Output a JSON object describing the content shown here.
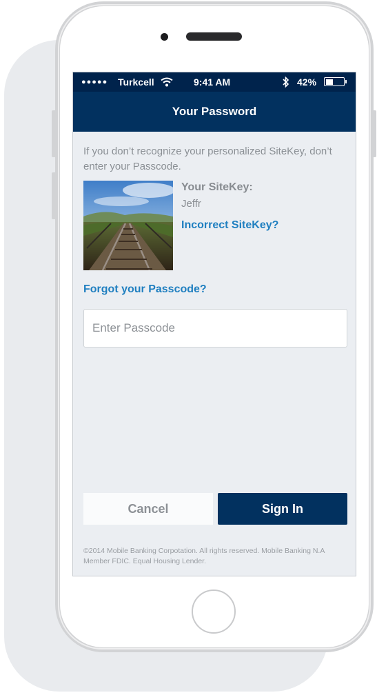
{
  "status_bar": {
    "carrier": "Turkcell",
    "signal_dots": "●●●●●",
    "time": "9:41 AM",
    "battery_percent": "42%",
    "battery_level": 0.42
  },
  "header": {
    "title": "Your Password"
  },
  "warning_text": "If you don’t recognize your personalized SiteKey, don’t enter your Passcode.",
  "sitekey": {
    "label": "Your SiteKey:",
    "name": "Jeffr",
    "incorrect_link": "Incorrect SiteKey?"
  },
  "forgot_link": "Forgot your Passcode?",
  "passcode": {
    "placeholder": "Enter Passcode",
    "value": ""
  },
  "buttons": {
    "cancel": "Cancel",
    "sign_in": "Sign In"
  },
  "footer": "©2014 Mobile Banking Corpotation. All rights reserved. Mobile Banking N.A Member FDIC. Equal Housing Lender.",
  "colors": {
    "navy": "#02315f",
    "status_bar": "#00234c",
    "link": "#1f7fc0",
    "background": "#ebeef2"
  }
}
